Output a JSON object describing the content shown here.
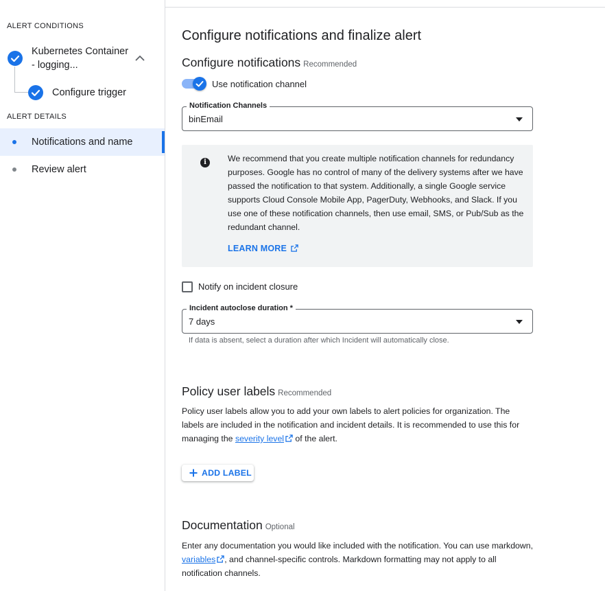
{
  "sidebar": {
    "alert_conditions_title": "ALERT CONDITIONS",
    "condition_label_line1": "Kubernetes Container",
    "condition_label_line2": "- logging...",
    "trigger_label": "Configure trigger",
    "alert_details_title": "ALERT DETAILS",
    "items": [
      {
        "label": "Notifications and name",
        "active": true
      },
      {
        "label": "Review alert",
        "active": false
      }
    ]
  },
  "main": {
    "title": "Configure notifications and finalize alert",
    "notifications": {
      "heading": "Configure notifications",
      "tag": "Recommended",
      "toggle_label": "Use notification channel",
      "toggle_on": true,
      "channels_legend": "Notification Channels",
      "channels_value": "binEmail",
      "info_text": "We recommend that you create multiple notification channels for redundancy purposes. Google has no control of many of the delivery systems after we have passed the notification to that system. Additionally, a single Google service supports Cloud Console Mobile App, PagerDuty, Webhooks, and Slack. If you use one of these notification channels, then use email, SMS, or Pub/Sub as the redundant channel.",
      "learn_more": "LEARN MORE",
      "notify_closure_label": "Notify on incident closure",
      "notify_closure_checked": false,
      "autoclose_legend": "Incident autoclose duration *",
      "autoclose_value": "7 days",
      "autoclose_helper": "If data is absent, select a duration after which Incident will automatically close."
    },
    "labels": {
      "heading": "Policy user labels",
      "tag": "Recommended",
      "text_before_link": "Policy user labels allow you to add your own labels to alert policies for organization. The labels are included in the notification and incident details. It is recommended to use this for managing the ",
      "link_text": "severity level",
      "text_after_link": " of the alert.",
      "add_button": "ADD LABEL"
    },
    "documentation": {
      "heading": "Documentation",
      "tag": "Optional",
      "text_before_link": "Enter any documentation you would like included with the notification. You can use markdown, ",
      "link_text": "variables",
      "text_after_link": ", and channel-specific controls. Markdown formatting may not apply to all notification channels."
    }
  },
  "colors": {
    "accent": "#1a73e8",
    "active_bg": "#e8f0fe",
    "info_bg": "#f1f3f4"
  }
}
